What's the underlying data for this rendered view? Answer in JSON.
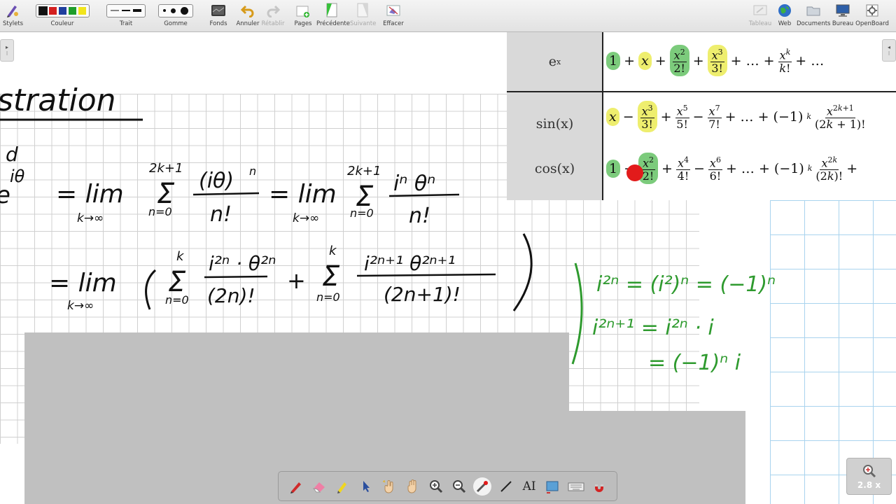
{
  "toolbar": {
    "left": [
      {
        "id": "stylets",
        "label": "Stylets",
        "icon": "pen-palette-icon"
      },
      {
        "id": "couleur",
        "label": "Couleur"
      },
      {
        "id": "trait",
        "label": "Trait"
      },
      {
        "id": "gomme",
        "label": "Gomme"
      },
      {
        "id": "fonds",
        "label": "Fonds",
        "icon": "background-icon"
      },
      {
        "id": "annuler",
        "label": "Annuler",
        "icon": "undo-icon"
      },
      {
        "id": "retablir",
        "label": "Rétablir",
        "icon": "redo-icon",
        "disabled": true
      },
      {
        "id": "pages",
        "label": "Pages",
        "icon": "add-page-icon"
      },
      {
        "id": "precedente",
        "label": "Précédente",
        "icon": "previous-page-icon"
      },
      {
        "id": "suivante",
        "label": "Suivante",
        "icon": "next-page-icon",
        "disabled": true
      },
      {
        "id": "effacer",
        "label": "Effacer",
        "icon": "clear-icon"
      }
    ],
    "right": [
      {
        "id": "tableau",
        "label": "Tableau",
        "icon": "board-icon",
        "disabled": true
      },
      {
        "id": "web",
        "label": "Web",
        "icon": "globe-icon"
      },
      {
        "id": "documents",
        "label": "Documents",
        "icon": "folder-icon"
      },
      {
        "id": "bureau",
        "label": "Bureau",
        "icon": "monitor-icon"
      },
      {
        "id": "openboard",
        "label": "OpenBoard",
        "icon": "gear-icon"
      }
    ],
    "colors": [
      "#111111",
      "#d42020",
      "#1f3f9e",
      "#1f9e2a",
      "#f2e51c"
    ],
    "selected_color": "#111111"
  },
  "series_table": {
    "rows": [
      {
        "label": "e",
        "label_sup": "x"
      },
      {
        "label": "sin(x)"
      },
      {
        "label": "cos(x)"
      }
    ]
  },
  "board_text": {
    "title_fragment": "stration",
    "line1": {
      "lhs_a": "d",
      "lhs_b": "e",
      "lhs_sup": "iθ",
      "eq1": "= lim",
      "lim_sub1": "k→∞",
      "sum1_top": "2k+1",
      "sum1_bottom": "n=0",
      "frac1_num": "(iθ)",
      "frac1_num_sup": "n",
      "frac1_den": "n!",
      "eq2": "= lim",
      "lim_sub2": "k→∞",
      "sum2_top": "2k+1",
      "sum2_bottom": "n=0",
      "frac2_num": "iⁿ θⁿ",
      "frac2_den": "n!"
    },
    "line2": {
      "eq": "= lim",
      "lim_sub": "k→∞",
      "sumA_top": "k",
      "sumA_bottom": "n=0",
      "fracA_num": "i²ⁿ · θ²ⁿ",
      "fracA_den": "(2n)!",
      "plus": "+",
      "sumB_top": "k",
      "sumB_bottom": "n=0",
      "fracB_num": "i²ⁿ⁺¹ θ²ⁿ⁺¹",
      "fracB_den": "(2n+1)!"
    },
    "notes": [
      "i²ⁿ = (i²)ⁿ = (−1)ⁿ",
      "i²ⁿ⁺¹ = i²ⁿ · i",
      "= (−1)ⁿ i"
    ]
  },
  "zoom": {
    "value": "2.8 x",
    "icon": "zoom-icon"
  },
  "dock_tools": [
    {
      "id": "pen",
      "icon": "pen-icon"
    },
    {
      "id": "eraser",
      "icon": "eraser-icon"
    },
    {
      "id": "highlighter",
      "icon": "highlighter-icon"
    },
    {
      "id": "select",
      "icon": "cursor-arrow-icon"
    },
    {
      "id": "interact",
      "icon": "hand-sparkle-icon"
    },
    {
      "id": "pan",
      "icon": "hand-pan-icon"
    },
    {
      "id": "zoom-in",
      "icon": "zoom-in-icon"
    },
    {
      "id": "zoom-out",
      "icon": "zoom-out-icon"
    },
    {
      "id": "laser",
      "icon": "laser-pointer-icon",
      "active": true
    },
    {
      "id": "line",
      "icon": "line-icon"
    },
    {
      "id": "text",
      "icon": "text-tool-icon",
      "label": "AI"
    },
    {
      "id": "capture",
      "icon": "capture-icon"
    },
    {
      "id": "keyboard",
      "icon": "keyboard-icon"
    },
    {
      "id": "magnet",
      "icon": "magnet-icon"
    }
  ]
}
